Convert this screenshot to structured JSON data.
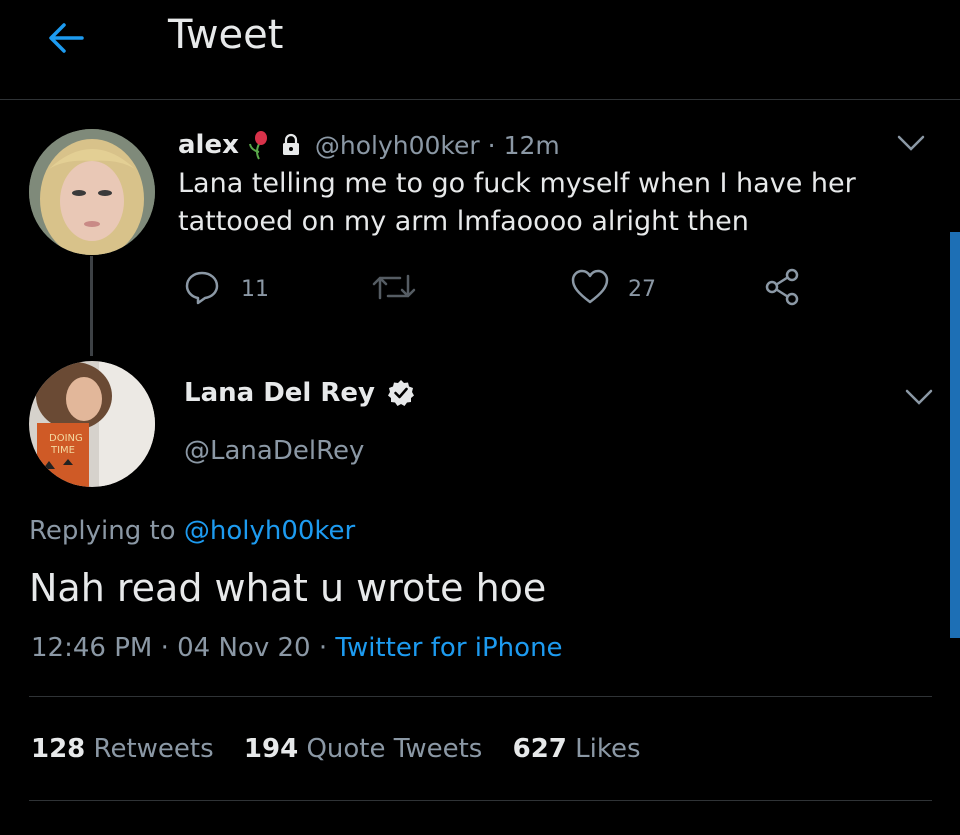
{
  "header": {
    "title": "Tweet",
    "back_icon": "arrow-left-icon"
  },
  "parent_tweet": {
    "display_name": "alex",
    "emoji_icon": "rose-emoji-icon",
    "lock_icon": "lock-icon",
    "handle": "@holyh00ker",
    "separator": "·",
    "time": "12m",
    "text": "Lana telling me to go fuck myself when I have her tattooed on my arm lmfaoooo alright then",
    "reply_count": "11",
    "retweet_count": "",
    "like_count": "27"
  },
  "main_tweet": {
    "display_name": "Lana Del Rey",
    "handle": "@LanaDelRey",
    "replying_prefix": "Replying to",
    "replying_to": "@holyh00ker",
    "text": "Nah read what u wrote hoe",
    "time": "12:46 PM",
    "sep1": "·",
    "date": "04 Nov 20",
    "sep2": "·",
    "source": "Twitter for iPhone",
    "stats": {
      "retweets_num": "128",
      "retweets_label": "Retweets",
      "quotes_num": "194",
      "quotes_label": "Quote Tweets",
      "likes_num": "627",
      "likes_label": "Likes"
    }
  },
  "colors": {
    "accent": "#1d9bf0",
    "muted": "#8b98a5",
    "background": "#000000"
  }
}
